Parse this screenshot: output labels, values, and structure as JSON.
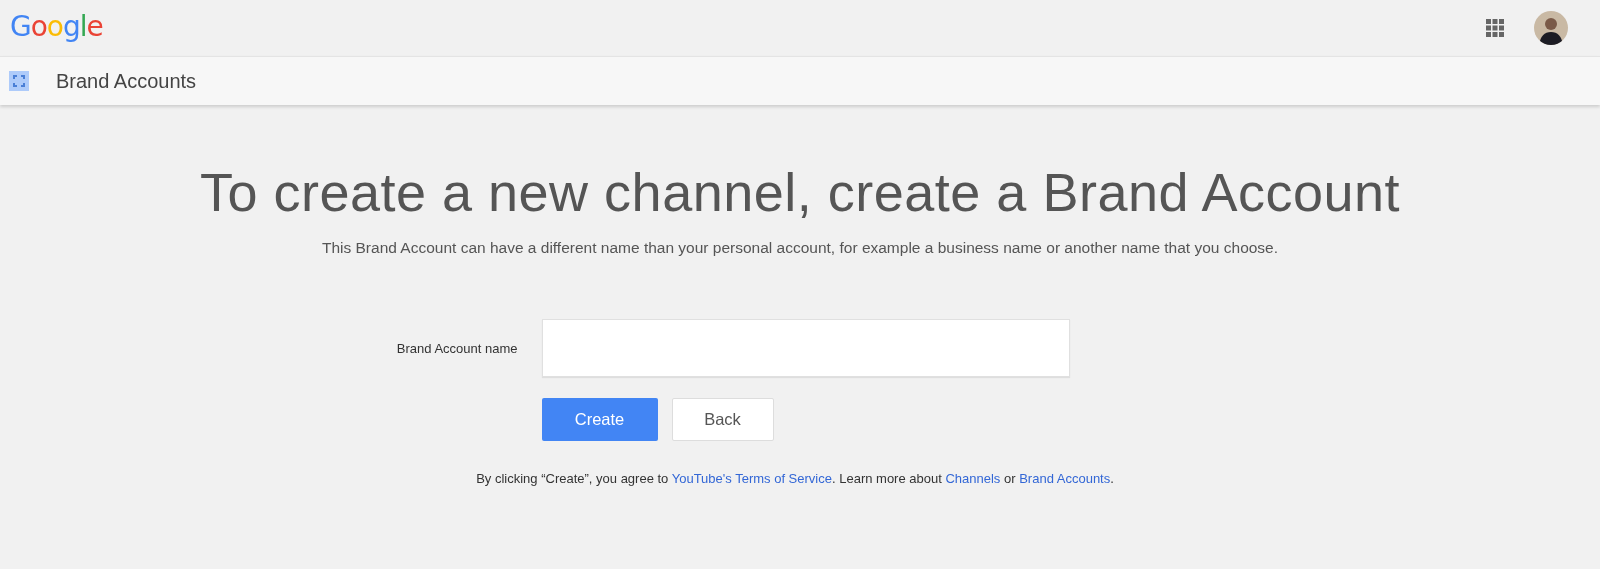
{
  "header": {
    "logo": "Google"
  },
  "subheader": {
    "title": "Brand Accounts"
  },
  "heading": "To create a new channel, create a Brand Account",
  "description": "This Brand Account can have a different name than your personal account, for example a business name or another name that you choose.",
  "form": {
    "label": "Brand Account name"
  },
  "buttons": [
    {
      "label": "Create",
      "kind": "primary"
    },
    {
      "label": "Back",
      "kind": "secondary"
    }
  ],
  "footer": [
    {
      "kind": "text",
      "text": "By clicking “Create”, you agree to "
    },
    {
      "kind": "link",
      "text": "YouTube's Terms of Service"
    },
    {
      "kind": "text",
      "text": ". Learn more about "
    },
    {
      "kind": "link",
      "text": "Channels"
    },
    {
      "kind": "text",
      "text": " or "
    },
    {
      "kind": "link",
      "text": "Brand Accounts"
    },
    {
      "kind": "text",
      "text": "."
    }
  ]
}
